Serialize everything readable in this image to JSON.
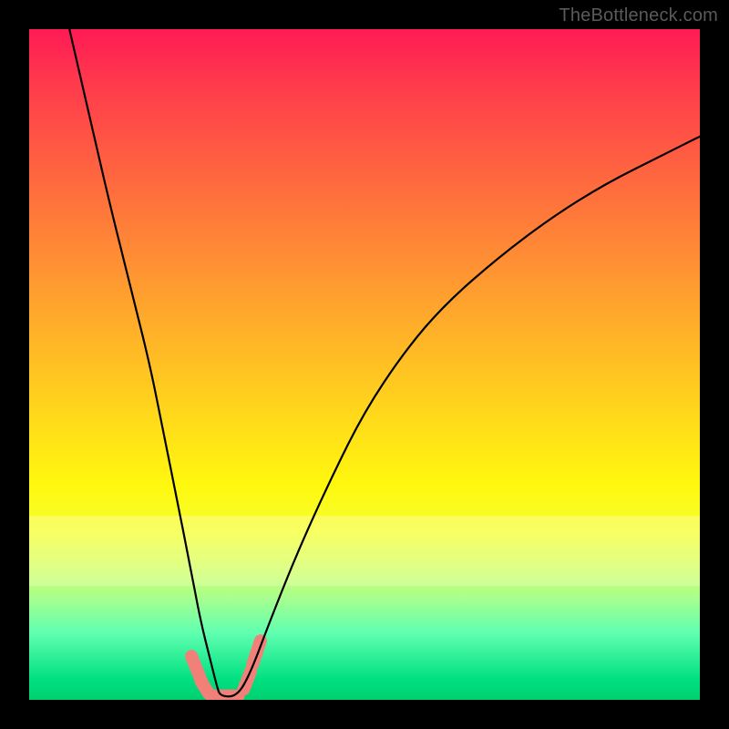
{
  "watermark": "TheBottleneck.com",
  "chart_data": {
    "type": "line",
    "title": "",
    "xlabel": "",
    "ylabel": "",
    "xlim": [
      0,
      100
    ],
    "ylim": [
      0,
      100
    ],
    "grid": false,
    "series": [
      {
        "name": "bottleneck-curve",
        "color": "#000000",
        "x": [
          6,
          9,
          12,
          15,
          18,
          20,
          22,
          24,
          25.5,
          27,
          28,
          28.5,
          31,
          33,
          36,
          40,
          45,
          50,
          56,
          62,
          70,
          78,
          86,
          94,
          100
        ],
        "y": [
          100,
          87,
          74,
          62,
          50,
          40,
          30,
          20,
          12,
          6,
          2,
          0.5,
          0.5,
          4,
          12,
          22,
          33,
          43,
          52,
          59,
          66,
          72,
          77,
          81,
          84
        ]
      }
    ],
    "annotations": [
      {
        "name": "trough-marker",
        "shape": "rounded-segment",
        "color": "#f08078",
        "points": [
          [
            24.2,
            6.5
          ],
          [
            25.8,
            2.5
          ]
        ]
      },
      {
        "name": "trough-marker",
        "shape": "rounded-segment",
        "color": "#f08078",
        "points": [
          [
            25.6,
            2.8
          ],
          [
            26.8,
            0.9
          ]
        ]
      },
      {
        "name": "trough-marker",
        "shape": "rounded-segment",
        "color": "#f08078",
        "points": [
          [
            27.3,
            0.6
          ],
          [
            31.2,
            0.6
          ]
        ]
      },
      {
        "name": "trough-marker",
        "shape": "rounded-segment",
        "color": "#f08078",
        "points": [
          [
            32.0,
            1.6
          ],
          [
            33.0,
            4.2
          ]
        ]
      },
      {
        "name": "trough-marker",
        "shape": "rounded-segment",
        "color": "#f08078",
        "points": [
          [
            33.3,
            5.2
          ],
          [
            34.5,
            8.8
          ]
        ]
      }
    ],
    "background": {
      "type": "vertical-gradient",
      "stops": [
        {
          "pos": 0.0,
          "color": "#00d070"
        },
        {
          "pos": 0.1,
          "color": "#60ffb0"
        },
        {
          "pos": 0.2,
          "color": "#d5ff60"
        },
        {
          "pos": 0.32,
          "color": "#fff80e"
        },
        {
          "pos": 0.52,
          "color": "#ffba26"
        },
        {
          "pos": 0.72,
          "color": "#ff7a3a"
        },
        {
          "pos": 0.92,
          "color": "#ff3a4c"
        },
        {
          "pos": 1.0,
          "color": "#ff1a55"
        }
      ]
    }
  }
}
